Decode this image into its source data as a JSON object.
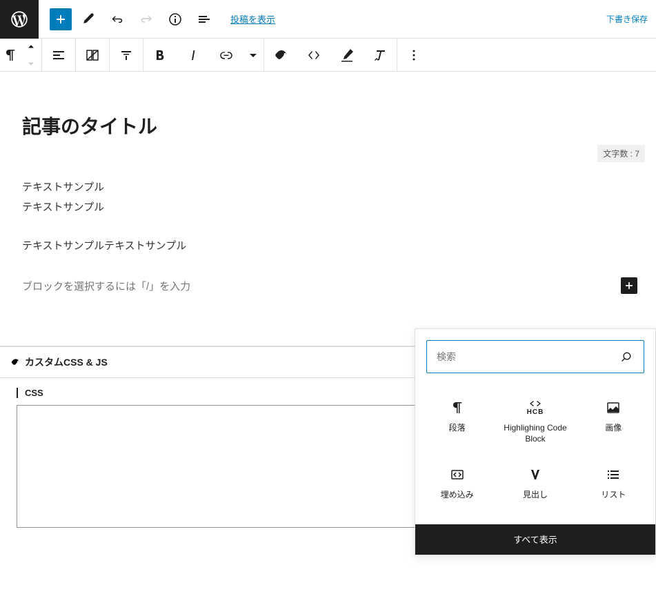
{
  "topbar": {
    "view_post": "投稿を表示",
    "save_draft": "下書き保存"
  },
  "editor": {
    "title": "記事のタイトル",
    "word_count": "文字数 : 7",
    "para1_line1": "テキストサンプル",
    "para1_line2": "テキストサンプル",
    "para2": "テキストサンプルテキストサンプル",
    "placeholder": "ブロックを選択するには「/」を入力"
  },
  "metabox": {
    "custom_css_title": "カスタムCSS & JS",
    "css_label": "CSS"
  },
  "inserter": {
    "search_placeholder": "検索",
    "blocks": {
      "paragraph": "段落",
      "hcb": "Highlighing Code Block",
      "image": "画像",
      "embed": "埋め込み",
      "heading": "見出し",
      "list": "リスト"
    },
    "show_all": "すべて表示"
  }
}
